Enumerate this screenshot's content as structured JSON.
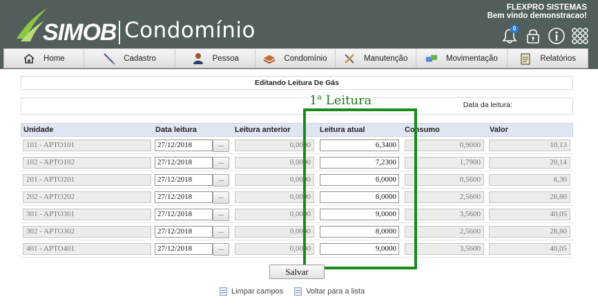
{
  "header": {
    "logo_simob": "SIMOB",
    "logo_condominio": "Condomínio",
    "company_name": "FLEXPRO SISTEMAS",
    "welcome": "Bem vindo demonstracao!",
    "notification_count": "0"
  },
  "nav": [
    {
      "label": "Home",
      "icon": "home-icon"
    },
    {
      "label": "Cadastro",
      "icon": "pen-icon"
    },
    {
      "label": "Pessoa",
      "icon": "person-icon"
    },
    {
      "label": "Condomínio",
      "icon": "building-icon"
    },
    {
      "label": "Manutenção",
      "icon": "tools-icon"
    },
    {
      "label": "Movimentação",
      "icon": "exchange-icon"
    },
    {
      "label": "Relatórios",
      "icon": "report-icon"
    }
  ],
  "panel": {
    "title": "Editando Leitura De Gás",
    "date_label": "Data da leitura:"
  },
  "annotation": {
    "number": "1",
    "sup": "a",
    "text": "Leitura"
  },
  "table": {
    "headers": [
      "Unidade",
      "Data leitura",
      "Leitura anterior",
      "Leitura atual",
      "Consumo",
      "Valor"
    ],
    "dots_label": "...",
    "rows": [
      {
        "unidade": "101 - APTO101",
        "data": "27/12/2018",
        "anterior": "0,0000",
        "atual": "6,3400",
        "consumo": "0,9000",
        "valor": "10,13"
      },
      {
        "unidade": "102 - APTO102",
        "data": "27/12/2018",
        "anterior": "0,0000",
        "atual": "7,2300",
        "consumo": "1,7900",
        "valor": "20,14"
      },
      {
        "unidade": "201 - APTO201",
        "data": "27/12/2018",
        "anterior": "0,0000",
        "atual": "6,0000",
        "consumo": "0,5600",
        "valor": "6,30"
      },
      {
        "unidade": "202 - APTO202",
        "data": "27/12/2018",
        "anterior": "0,0000",
        "atual": "8,0000",
        "consumo": "2,5600",
        "valor": "28,80"
      },
      {
        "unidade": "301 - APTO301",
        "data": "27/12/2018",
        "anterior": "0,0000",
        "atual": "9,0000",
        "consumo": "3,5600",
        "valor": "40,05"
      },
      {
        "unidade": "302 - APTO302",
        "data": "27/12/2018",
        "anterior": "0,0000",
        "atual": "8,0000",
        "consumo": "2,5600",
        "valor": "28,80"
      },
      {
        "unidade": "401 - APTO401",
        "data": "27/12/2018",
        "anterior": "0,0000",
        "atual": "9,0000",
        "consumo": "3,5600",
        "valor": "40,05"
      }
    ]
  },
  "actions": {
    "save_label": "Salvar",
    "clear_label": "Limpar campos",
    "back_label": "Voltar para a lista"
  },
  "colors": {
    "header_bg": "#515e5c",
    "logo_green": "#8cc63f",
    "annotation_green": "#1a8a1a",
    "table_header_bg": "#dfe6f1"
  }
}
